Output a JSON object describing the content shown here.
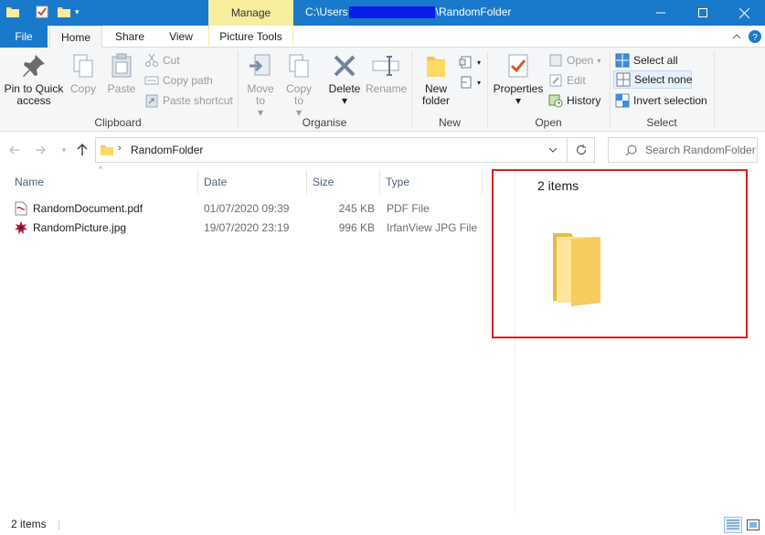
{
  "window": {
    "context_tab": "Manage",
    "title_prefix": "C:\\Users",
    "title_suffix": "\\RandomFolder"
  },
  "tabs": [
    {
      "label": "File"
    },
    {
      "label": "Home"
    },
    {
      "label": "Share"
    },
    {
      "label": "View"
    },
    {
      "label": "Picture Tools"
    }
  ],
  "ribbon": {
    "clipboard": {
      "group": "Clipboard",
      "pin": "Pin to Quick access",
      "copy": "Copy",
      "paste": "Paste",
      "cut": "Cut",
      "copy_path": "Copy path",
      "paste_shortcut": "Paste shortcut"
    },
    "organise": {
      "group": "Organise",
      "move_to": "Move to",
      "copy_to": "Copy to",
      "delete": "Delete",
      "rename": "Rename"
    },
    "new": {
      "group": "New",
      "new_folder": "New folder"
    },
    "open": {
      "group": "Open",
      "properties": "Properties",
      "open": "Open",
      "edit": "Edit",
      "history": "History"
    },
    "select": {
      "group": "Select",
      "select_all": "Select all",
      "select_none": "Select none",
      "invert": "Invert selection"
    }
  },
  "address": {
    "crumb": "RandomFolder",
    "search_placeholder": "Search RandomFolder"
  },
  "columns": {
    "name": "Name",
    "date": "Date",
    "size": "Size",
    "type": "Type"
  },
  "files": [
    {
      "name": "RandomDocument.pdf",
      "date": "01/07/2020 09:39",
      "size": "245 KB",
      "type": "PDF File",
      "icon": "pdf-file-icon"
    },
    {
      "name": "RandomPicture.jpg",
      "date": "19/07/2020 23:19",
      "size": "996 KB",
      "type": "IrfanView JPG File",
      "icon": "irfanview-icon"
    }
  ],
  "details": {
    "count": "2 items"
  },
  "status": {
    "text": "2 items"
  },
  "colors": {
    "titlebar": "#1979ca",
    "manage_tab": "#f7ef9e",
    "highlight": "#e01e1e",
    "redaction": "#0a1ee8"
  }
}
